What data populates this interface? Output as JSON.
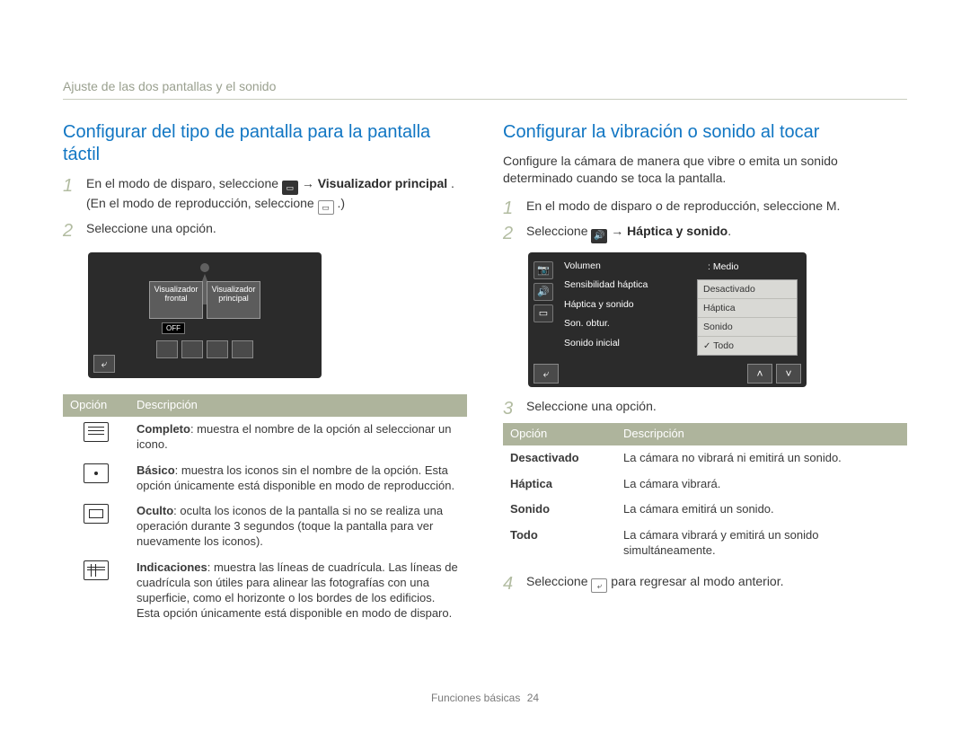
{
  "breadcrumb": "Ajuste de las dos pantallas y el sonido",
  "left": {
    "title": "Conﬁgurar del tipo de pantalla para la pantalla táctil",
    "step1_a": "En el modo de disparo, seleccione ",
    "step1_b": " → ",
    "step1_bold1": "Visualizador principal",
    "step1_c": ". (En el modo de reproducción, seleccione ",
    "step1_d": ".)",
    "step2": "Seleccione una opción.",
    "shot": {
      "tile1a": "Visualizador",
      "tile1b": "frontal",
      "tile2a": "Visualizador",
      "tile2b": "principal",
      "off": "OFF"
    },
    "table": {
      "h1": "Opción",
      "h2": "Descripción",
      "rows": [
        {
          "label": "Completo",
          "desc": ": muestra el nombre de la opción al seleccionar un icono."
        },
        {
          "label": "Básico",
          "desc": ": muestra los iconos sin el nombre de la opción. Esta opción únicamente está disponible en modo de reproducción."
        },
        {
          "label": "Oculto",
          "desc": ": oculta los iconos de la pantalla si no se realiza una operación durante 3 segundos (toque la pantalla para ver nuevamente los iconos)."
        },
        {
          "label": "Indicaciones",
          "desc": ": muestra las líneas de cuadrícula. Las líneas de cuadrícula son útiles para alinear las fotografías con una superﬁcie, como el horizonte o los bordes de los ediﬁcios. Esta opción únicamente está disponible en modo de disparo."
        }
      ]
    }
  },
  "right": {
    "title": "Conﬁgurar la vibración o sonido al tocar",
    "intro": "Conﬁgure la cámara de manera que vibre o emita un sonido determinado cuando se toca la pantalla.",
    "step1": "En el modo de disparo o de reproducción, seleccione M.",
    "step2_a": "Seleccione ",
    "step2_b": " → ",
    "step2_bold": "Háptica y sonido",
    "step2_c": ".",
    "shot": {
      "menu": [
        "Volumen",
        "Sensibilidad háptica",
        "Háptica y sonido",
        "Son. obtur.",
        "Sonido inicial"
      ],
      "medio": ": Medio",
      "options": [
        "Desactivado",
        "Háptica",
        "Sonido",
        "Todo"
      ]
    },
    "step3": "Seleccione una opción.",
    "table": {
      "h1": "Opción",
      "h2": "Descripción",
      "rows": [
        {
          "opt": "Desactivado",
          "desc": "La cámara no vibrará ni emitirá un sonido."
        },
        {
          "opt": "Háptica",
          "desc": "La cámara vibrará."
        },
        {
          "opt": "Sonido",
          "desc": "La cámara emitirá un sonido."
        },
        {
          "opt": "Todo",
          "desc": "La cámara vibrará y emitirá un sonido simultáneamente."
        }
      ]
    },
    "step4_a": "Seleccione ",
    "step4_b": " para regresar al modo anterior."
  },
  "footer": {
    "section": "Funciones básicas",
    "page": "24"
  }
}
